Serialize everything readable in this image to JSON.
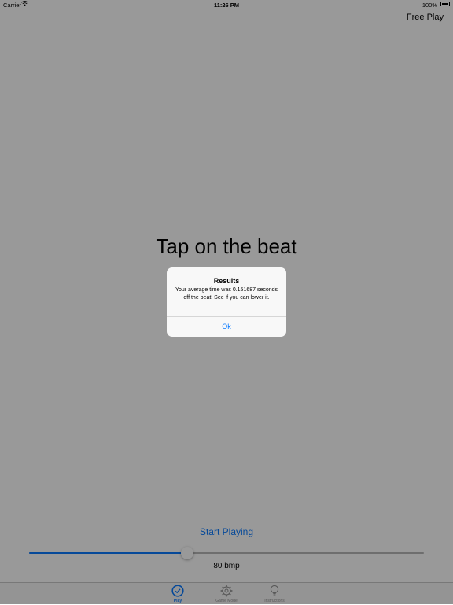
{
  "status_bar": {
    "carrier": "Carrier",
    "time": "11:26 PM",
    "battery": "100%"
  },
  "header": {
    "mode_label": "Free Play"
  },
  "main": {
    "title": "Tap on the beat",
    "start_button_label": "Start Playing",
    "tempo_slider": {
      "value_fraction": 0.4
    },
    "bpm_label": "80 bmp"
  },
  "tab_bar": {
    "items": [
      {
        "label": "Play",
        "icon": "clock-icon",
        "active": true
      },
      {
        "label": "Game Mode",
        "icon": "gear-icon",
        "active": false
      },
      {
        "label": "Instructions",
        "icon": "lightbulb-icon",
        "active": false
      }
    ]
  },
  "alert": {
    "title": "Results",
    "message": "Your average time was 0.151687 seconds off the beat! See if you can lower it.",
    "ok_label": "Ok"
  },
  "colors": {
    "accent": "#0a7aff",
    "dim_overlay": "rgba(0,0,0,0.4)"
  }
}
